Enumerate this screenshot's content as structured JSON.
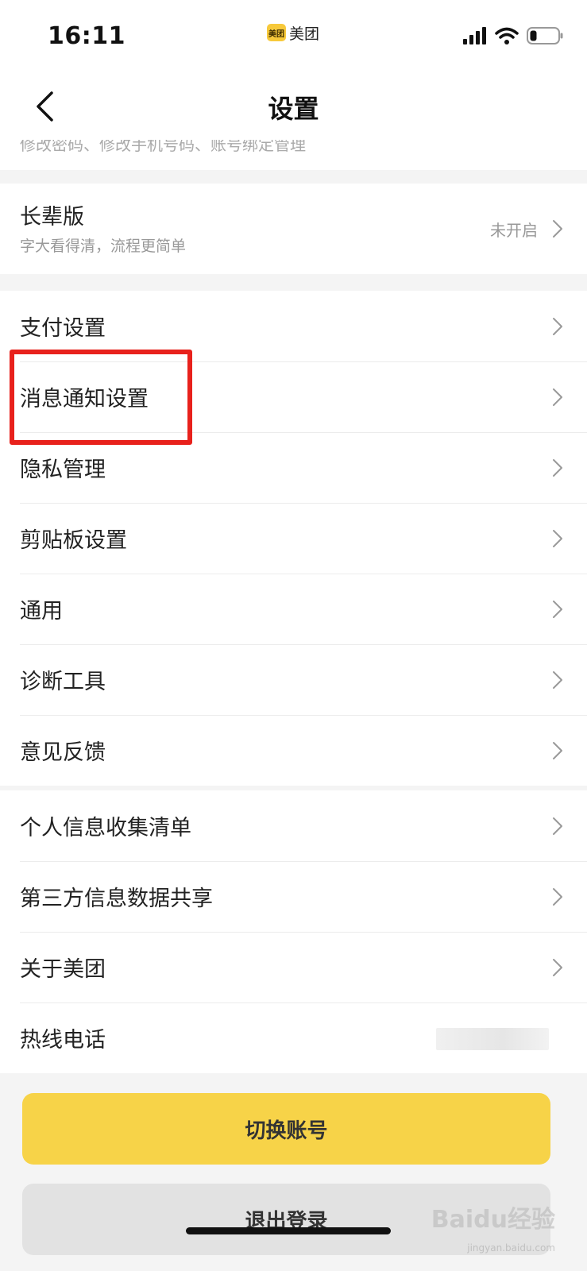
{
  "status_bar": {
    "time": "16:11",
    "app_logo_text": "美团",
    "app_name": "美团"
  },
  "header": {
    "title": "设置"
  },
  "account_row": {
    "subtitle": "修改密码、修改手机号码、账号绑定管理"
  },
  "elder_mode": {
    "label": "长辈版",
    "subtitle": "字大看得清，流程更简单",
    "value": "未开启"
  },
  "settings_group": {
    "items": [
      {
        "label": "支付设置"
      },
      {
        "label": "消息通知设置"
      },
      {
        "label": "隐私管理"
      },
      {
        "label": "剪贴板设置"
      },
      {
        "label": "通用"
      },
      {
        "label": "诊断工具"
      },
      {
        "label": "意见反馈"
      }
    ]
  },
  "info_group": {
    "items": [
      {
        "label": "个人信息收集清单"
      },
      {
        "label": "第三方信息数据共享"
      },
      {
        "label": "关于美团"
      },
      {
        "label": "热线电话"
      }
    ]
  },
  "buttons": {
    "switch_account": "切换账号",
    "logout": "退出登录"
  },
  "watermark": {
    "text": "Baidu经验",
    "sub": "jingyan.baidu.com"
  },
  "colors": {
    "accent_yellow": "#f7d348",
    "highlight_red": "#e8211c",
    "background": "#f4f4f4"
  }
}
